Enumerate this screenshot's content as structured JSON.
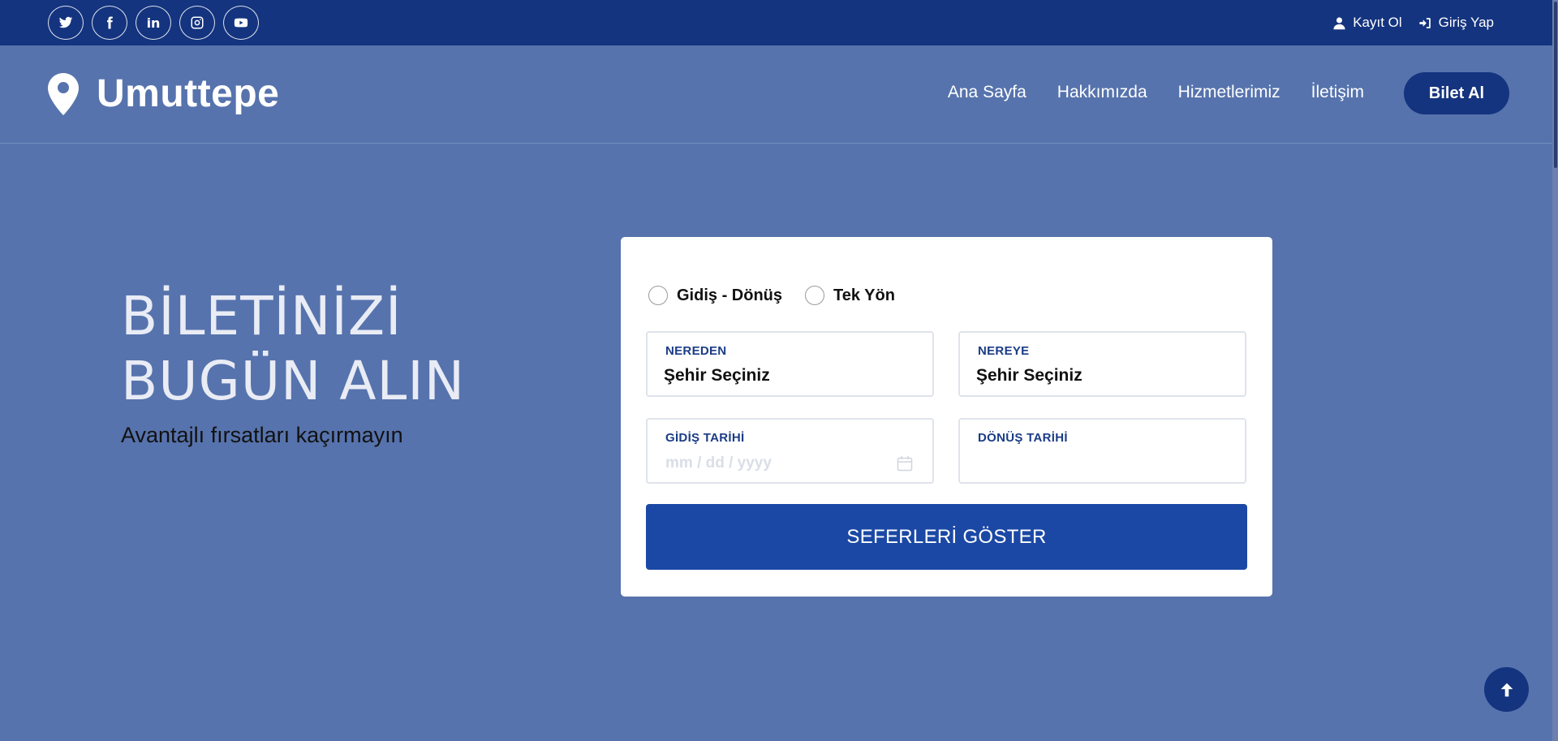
{
  "topbar": {
    "social": [
      {
        "icon": "twitter-icon"
      },
      {
        "icon": "facebook-icon"
      },
      {
        "icon": "linkedin-icon",
        "text": "in"
      },
      {
        "icon": "instagram-icon"
      },
      {
        "icon": "youtube-icon"
      }
    ],
    "register_label": "Kayıt Ol",
    "login_label": "Giriş Yap"
  },
  "navbar": {
    "brand": "Umuttepe",
    "links": [
      "Ana Sayfa",
      "Hakkımızda",
      "Hizmetlerimiz",
      "İletişim"
    ],
    "cta_label": "Bilet Al"
  },
  "hero": {
    "title_line1": "BİLETİNİZİ",
    "title_line2": "BUGÜN ALIN",
    "subtitle": "Avantajlı fırsatları kaçırmayın"
  },
  "booking": {
    "trip_options": [
      "Gidiş - Dönüş",
      "Tek Yön"
    ],
    "from": {
      "label": "NEREDEN",
      "value": "Şehir Seçiniz"
    },
    "to": {
      "label": "NEREYE",
      "value": "Şehir Seçiniz"
    },
    "depart": {
      "label": "GİDİŞ TARİHİ",
      "placeholder": "mm / dd / yyyy"
    },
    "return": {
      "label": "DÖNÜŞ TARİHİ",
      "value": ""
    },
    "submit_label": "SEFERLERİ GÖSTER"
  },
  "colors": {
    "topbar_bg": "#14347f",
    "page_bg": "#5673ad",
    "button_bg": "#1b48a5",
    "field_label": "#1b3c86"
  }
}
